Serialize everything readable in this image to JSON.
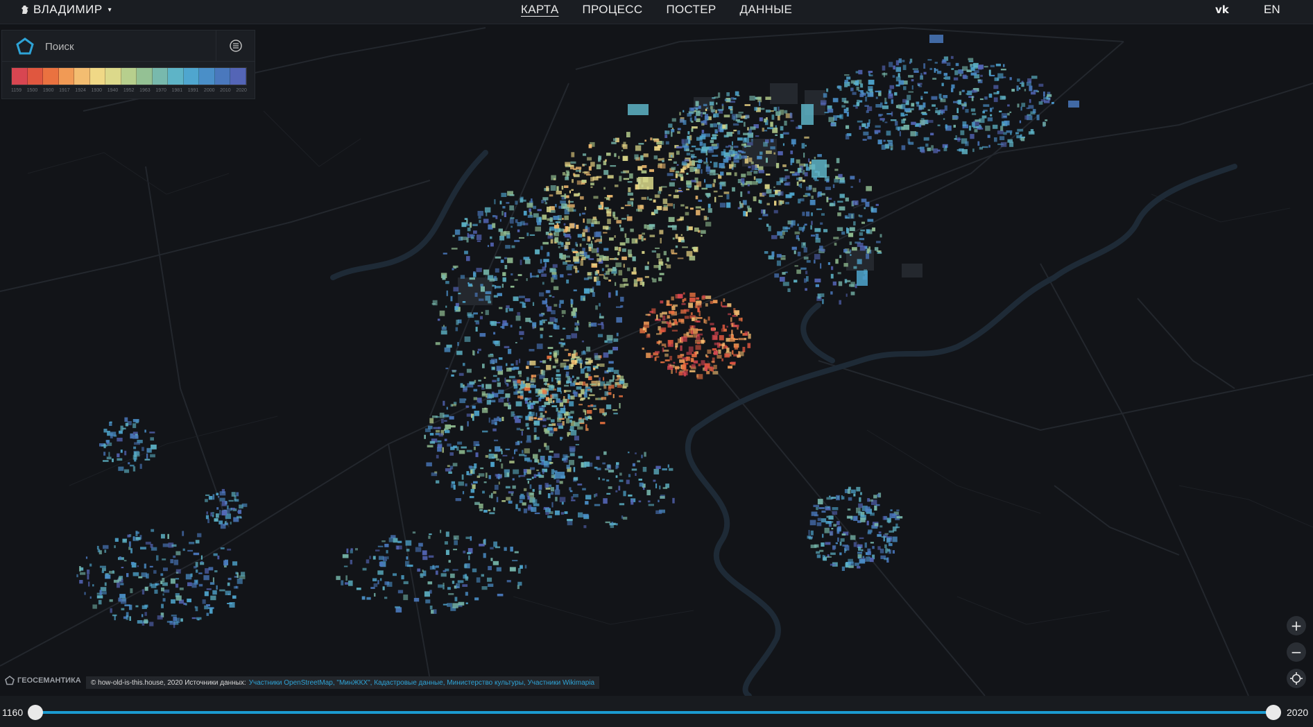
{
  "header": {
    "city": "ВЛАДИМИР",
    "nav": [
      "КАРТА",
      "ПРОЦЕСС",
      "ПОСТЕР",
      "ДАННЫЕ"
    ],
    "social": "vk",
    "lang": "EN"
  },
  "search": {
    "placeholder": "Поиск"
  },
  "legend": {
    "labels": [
      "1159",
      "1500",
      "1900",
      "1917",
      "1924",
      "1930",
      "1940",
      "1952",
      "1963",
      "1970",
      "1981",
      "1991",
      "2000",
      "2010",
      "2020"
    ],
    "colors": [
      "#d84651",
      "#e0573f",
      "#ea7240",
      "#f19a55",
      "#f3bd71",
      "#f0d886",
      "#dcd98b",
      "#b7cf8d",
      "#94c194",
      "#78b9ad",
      "#5eb4c7",
      "#4fa6cf",
      "#4a8fc8",
      "#4a78bd",
      "#5465b6"
    ]
  },
  "attribution": {
    "brand": "ГЕОСЕМАНТИКА",
    "text": "© how-old-is-this.house, 2020 Источники данных:",
    "links": "Участники OpenStreetMap, \"МинЖКХ\", Кадастровые данные, Министерство культуры, Участники Wikimapia"
  },
  "timeline": {
    "min": "1160",
    "max": "2020",
    "start": 1160,
    "end": 2020
  },
  "controls": {
    "zoom_in": "+",
    "zoom_out": "−"
  },
  "colors": {
    "accent": "#1b9bd1",
    "background": "#121418",
    "river": "#1e2a36"
  }
}
